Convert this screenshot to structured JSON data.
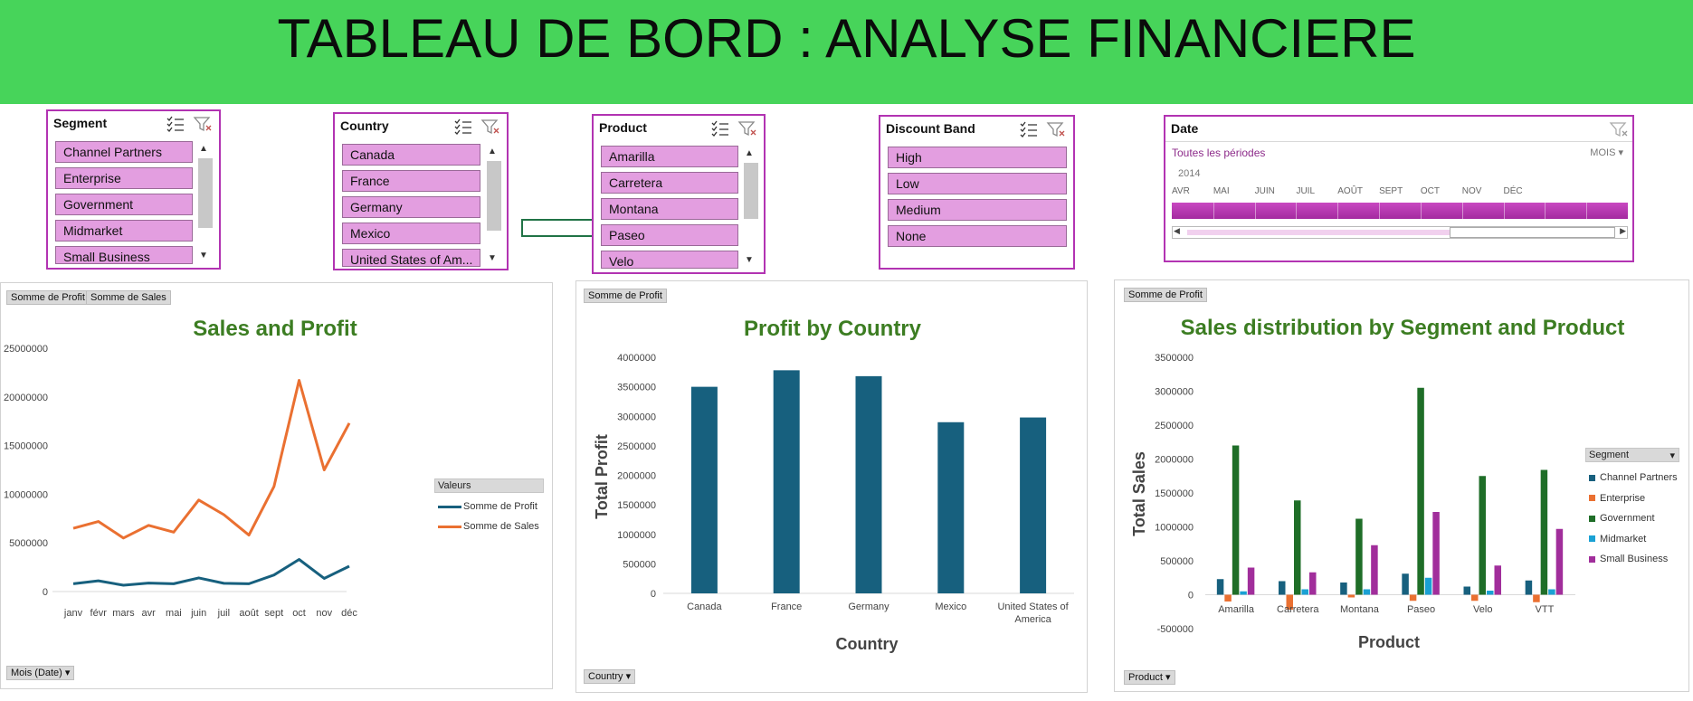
{
  "header": {
    "title": "TABLEAU DE BORD : ANALYSE FINANCIERE"
  },
  "colors": {
    "banner": "#47d45a",
    "slicer_border": "#b233b2",
    "slicer_item": "#e39ee0",
    "chart_title": "#3c7d22",
    "profit_line": "#17607e",
    "sales_line": "#ea7031"
  },
  "slicers": {
    "segment": {
      "title": "Segment",
      "items": [
        "Channel Partners",
        "Enterprise",
        "Government",
        "Midmarket",
        "Small Business"
      ]
    },
    "country": {
      "title": "Country",
      "items": [
        "Canada",
        "France",
        "Germany",
        "Mexico",
        "United States of Am..."
      ]
    },
    "product": {
      "title": "Product",
      "items": [
        "Amarilla",
        "Carretera",
        "Montana",
        "Paseo",
        "Velo"
      ]
    },
    "discount": {
      "title": "Discount Band",
      "items": [
        "High",
        "Low",
        "Medium",
        "None"
      ]
    },
    "date": {
      "title": "Date",
      "all_periods": "Toutes les périodes",
      "level": "MOIS",
      "year": "2014",
      "months": [
        "AVR",
        "MAI",
        "JUIN",
        "JUIL",
        "AOÛT",
        "SEPT",
        "OCT",
        "NOV",
        "DÉC"
      ]
    }
  },
  "panels": {
    "sales_profit": {
      "field_buttons": [
        "Somme de Profit",
        "Somme de  Sales"
      ],
      "legend_title": "Valeurs",
      "axis_button": "Mois (Date)"
    },
    "profit_country": {
      "field_buttons": [
        "Somme de Profit"
      ],
      "axis_button": "Country"
    },
    "segment_product": {
      "field_buttons": [
        "Somme de Profit"
      ],
      "legend_title": "Segment",
      "axis_button": "Product"
    }
  },
  "chart_data": [
    {
      "type": "line",
      "title": "Sales and Profit",
      "categories": [
        "janv",
        "févr",
        "mars",
        "avr",
        "mai",
        "juin",
        "juil",
        "août",
        "sept",
        "oct",
        "nov",
        "déc"
      ],
      "ylim": [
        0,
        25000000
      ],
      "yticks": [
        "0",
        "5000000",
        "10000000",
        "15000000",
        "20000000",
        "25000000"
      ],
      "series": [
        {
          "name": "Somme de Profit",
          "color": "#17607e",
          "values": [
            800000,
            1100000,
            650000,
            870000,
            800000,
            1400000,
            850000,
            800000,
            1700000,
            3300000,
            1350000,
            2600000
          ]
        },
        {
          "name": "Somme de  Sales",
          "color": "#ea7031",
          "values": [
            6500000,
            7200000,
            5500000,
            6800000,
            6100000,
            9400000,
            7900000,
            5800000,
            10800000,
            21700000,
            12500000,
            17300000
          ]
        }
      ]
    },
    {
      "type": "bar",
      "title": "Profit by Country",
      "categories": [
        "Canada",
        "France",
        "Germany",
        "Mexico",
        "United States of America"
      ],
      "values": [
        3500000,
        3780000,
        3680000,
        2900000,
        2980000
      ],
      "ylim": [
        0,
        4000000
      ],
      "yticks": [
        "0",
        "500000",
        "1000000",
        "1500000",
        "2000000",
        "2500000",
        "3000000",
        "3500000",
        "4000000"
      ],
      "xlabel": "Country",
      "ylabel": "Total  Profit",
      "color": "#17607e"
    },
    {
      "type": "bar",
      "title": "Sales distribution by Segment and Product",
      "categories": [
        "Amarilla",
        "Carretera",
        "Montana",
        "Paseo",
        "Velo",
        "VTT"
      ],
      "ylim": [
        -500000,
        3500000
      ],
      "yticks": [
        "-500000",
        "0",
        "500000",
        "1000000",
        "1500000",
        "2000000",
        "2500000",
        "3000000",
        "3500000"
      ],
      "xlabel": "Product",
      "ylabel": "Total Sales",
      "series": [
        {
          "name": "Channel Partners",
          "color": "#17607e",
          "values": [
            230000,
            200000,
            180000,
            310000,
            120000,
            210000
          ]
        },
        {
          "name": "Enterprise",
          "color": "#ea7031",
          "values": [
            -100000,
            -220000,
            -40000,
            -90000,
            -90000,
            -110000
          ]
        },
        {
          "name": "Government",
          "color": "#1f6e28",
          "values": [
            2200000,
            1390000,
            1120000,
            3050000,
            1750000,
            1840000
          ]
        },
        {
          "name": "Midmarket",
          "color": "#1aa1d4",
          "values": [
            50000,
            80000,
            80000,
            250000,
            60000,
            80000
          ]
        },
        {
          "name": "Small Business",
          "color": "#a12e9b",
          "values": [
            400000,
            330000,
            730000,
            1220000,
            430000,
            970000
          ]
        }
      ]
    }
  ]
}
